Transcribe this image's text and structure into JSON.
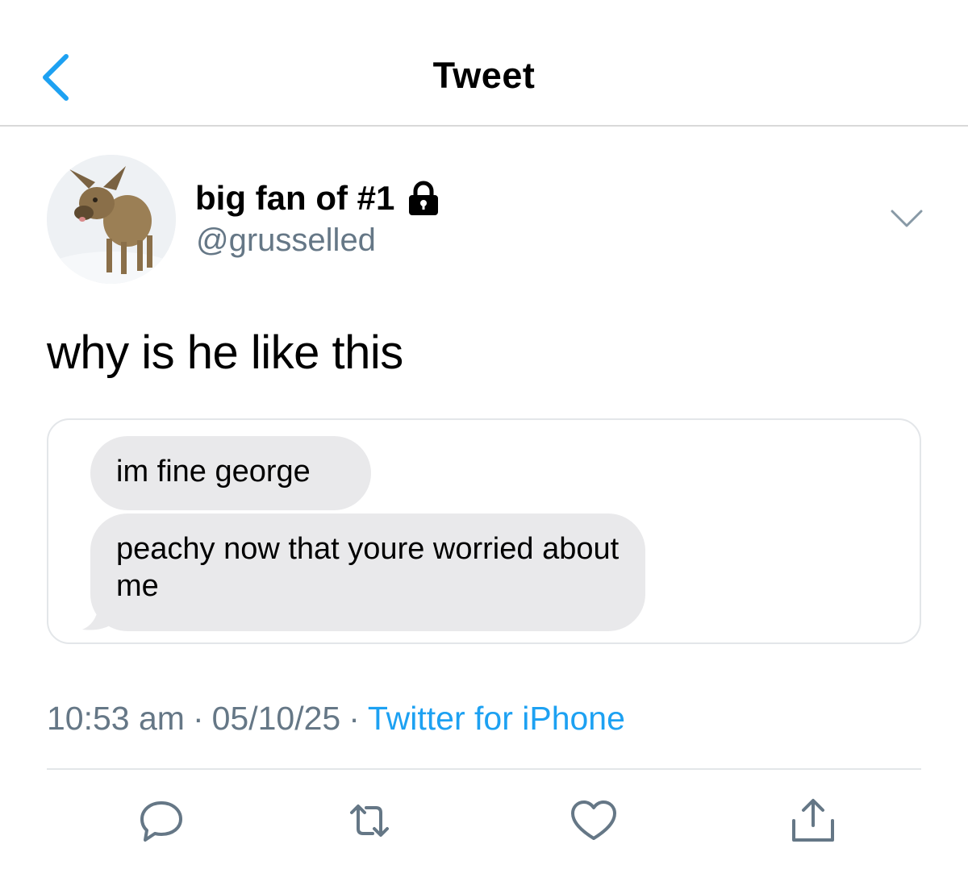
{
  "header": {
    "title": "Tweet",
    "back_icon": "chevron-left-icon"
  },
  "author": {
    "display_name": "big fan of #1",
    "handle": "@grusselled",
    "avatar": "deer-fawn-avatar",
    "protected_icon": "lock-icon"
  },
  "tweet": {
    "text": "why is he like this",
    "menu_icon": "chevron-down-icon"
  },
  "media": {
    "type": "text-message-screenshot",
    "messages": [
      "im fine george",
      "peachy now that youre worried about me"
    ],
    "bubble_color": "#e9e9eb"
  },
  "meta": {
    "time": "10:53 am",
    "separator": "·",
    "date": "05/10/25",
    "source": "Twitter for iPhone"
  },
  "actions": [
    {
      "name": "reply",
      "icon": "reply-bubble-icon"
    },
    {
      "name": "retweet",
      "icon": "retweet-icon"
    },
    {
      "name": "like",
      "icon": "heart-icon"
    },
    {
      "name": "share",
      "icon": "share-icon"
    }
  ],
  "colors": {
    "accent": "#1da1f2",
    "icon_gray": "#657786",
    "divider": "#e3e6e9"
  }
}
